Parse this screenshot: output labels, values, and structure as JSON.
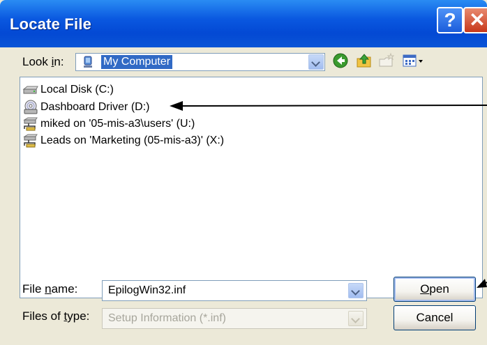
{
  "window": {
    "title": "Locate File",
    "help_label": "?",
    "close_label": "✕"
  },
  "lookin": {
    "label_pre": "Look ",
    "label_ul": "i",
    "label_post": "n:",
    "value": "My Computer"
  },
  "toolbar": {
    "back_icon": "back-icon",
    "up_icon": "up-folder-icon",
    "newfolder_icon": "new-folder-icon",
    "views_icon": "views-menu-icon"
  },
  "files": [
    {
      "label": "Local Disk (C:)",
      "icon": "hard-drive-icon"
    },
    {
      "label": "Dashboard Driver (D:)",
      "icon": "cd-drive-icon"
    },
    {
      "label": "miked on '05-mis-a3\\users' (U:)",
      "icon": "network-drive-icon"
    },
    {
      "label": "Leads on 'Marketing (05-mis-a3)' (X:)",
      "icon": "network-drive-icon"
    }
  ],
  "filename": {
    "label_pre": "File ",
    "label_ul": "n",
    "label_post": "ame:",
    "value": "EpilogWin32.inf"
  },
  "filetype": {
    "label_pre": "Files of ",
    "label_ul": "t",
    "label_post": "ype:",
    "value": "Setup Information (*.inf)"
  },
  "buttons": {
    "open_ul": "O",
    "open_post": "pen",
    "cancel": "Cancel"
  },
  "colors": {
    "titlebar": "#0a58e0",
    "selection": "#316ac5",
    "dialog_bg": "#ece9d8"
  }
}
